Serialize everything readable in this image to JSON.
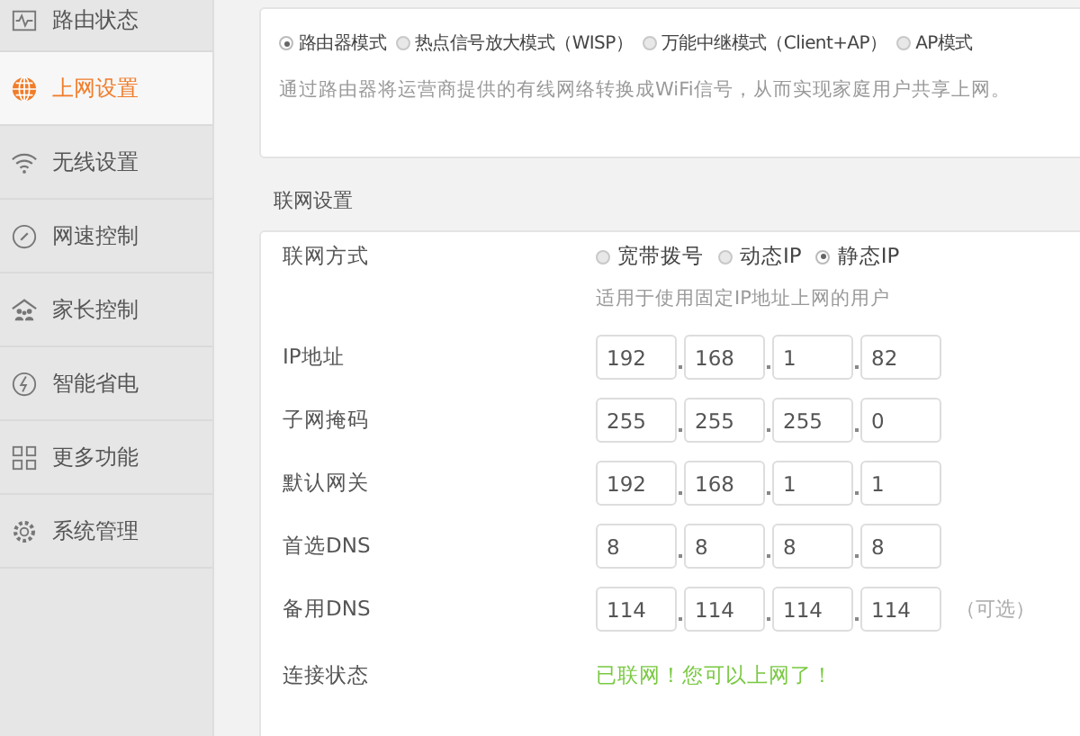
{
  "sidebar": {
    "items": [
      {
        "label": "路由状态",
        "selected": false
      },
      {
        "label": "上网设置",
        "selected": true
      },
      {
        "label": "无线设置",
        "selected": false
      },
      {
        "label": "网速控制",
        "selected": false
      },
      {
        "label": "家长控制",
        "selected": false
      },
      {
        "label": "智能省电",
        "selected": false
      },
      {
        "label": "更多功能",
        "selected": false
      },
      {
        "label": "系统管理",
        "selected": false
      }
    ]
  },
  "mode_card": {
    "modes": [
      {
        "label": "路由器模式",
        "selected": true
      },
      {
        "label": "热点信号放大模式（WISP）",
        "selected": false
      },
      {
        "label": "万能中继模式（Client+AP）",
        "selected": false
      },
      {
        "label": "AP模式",
        "selected": false
      }
    ],
    "description": "通过路由器将运营商提供的有线网络转换成WiFi信号，从而实现家庭用户共享上网。"
  },
  "section_title": "联网设置",
  "connection_type": {
    "label": "联网方式",
    "options": [
      {
        "label": "宽带拨号",
        "selected": false
      },
      {
        "label": "动态IP",
        "selected": false
      },
      {
        "label": "静态IP",
        "selected": true
      }
    ],
    "hint": "适用于使用固定IP地址上网的用户"
  },
  "fields": [
    {
      "label": "IP地址",
      "octets": [
        "192",
        "168",
        "1",
        "82"
      ]
    },
    {
      "label": "子网掩码",
      "octets": [
        "255",
        "255",
        "255",
        "0"
      ]
    },
    {
      "label": "默认网关",
      "octets": [
        "192",
        "168",
        "1",
        "1"
      ]
    },
    {
      "label": "首选DNS",
      "octets": [
        "8",
        "8",
        "8",
        "8"
      ]
    },
    {
      "label": "备用DNS",
      "octets": [
        "114",
        "114",
        "114",
        "114"
      ],
      "note": "（可选）"
    }
  ],
  "status": {
    "label": "连接状态",
    "value": "已联网！您可以上网了！"
  }
}
